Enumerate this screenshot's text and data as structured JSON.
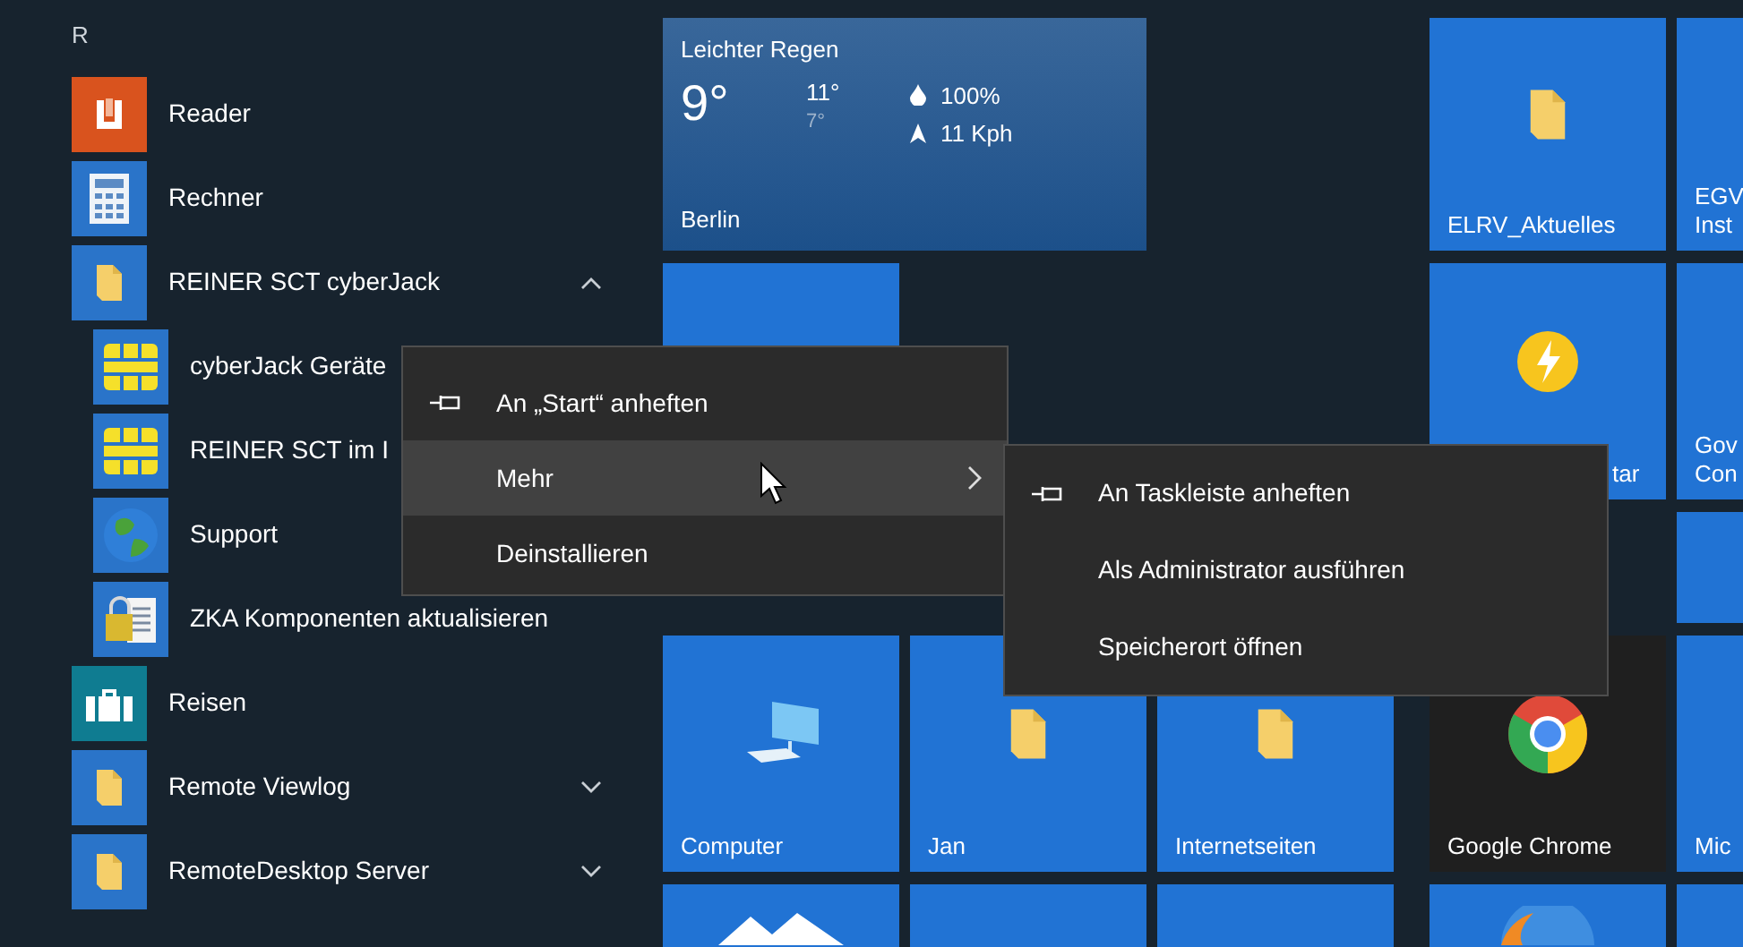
{
  "app_list": {
    "letter": "R",
    "items": [
      {
        "label": "Reader",
        "kind": "reader"
      },
      {
        "label": "Rechner",
        "kind": "calculator"
      },
      {
        "label": "REINER SCT cyberJack",
        "kind": "folder",
        "expanded": true,
        "children": [
          {
            "label": "cyberJack Geräte",
            "kind": "chip"
          },
          {
            "label": "REINER SCT im I",
            "kind": "chip"
          },
          {
            "label": "Support",
            "kind": "globe"
          },
          {
            "label": "ZKA Komponenten aktualisieren",
            "kind": "lock"
          }
        ]
      },
      {
        "label": "Reisen",
        "kind": "suitcase"
      },
      {
        "label": "Remote Viewlog",
        "kind": "folder",
        "expanded": false
      },
      {
        "label": "RemoteDesktop Server",
        "kind": "folder",
        "expanded": false
      }
    ]
  },
  "tile_groups": [
    {
      "tiles": [
        {
          "kind": "weather",
          "condition": "Leichter Regen",
          "temperature": "9°",
          "high": "11°",
          "low": "7°",
          "humidity": "100%",
          "wind": "11 Kph",
          "city": "Berlin"
        },
        {
          "kind": "plain"
        },
        {
          "kind": "computer",
          "label": "Computer"
        },
        {
          "kind": "folder",
          "label": "Jan"
        },
        {
          "kind": "folder",
          "label": "Internetseiten"
        },
        {
          "kind": "peaks"
        },
        {
          "kind": "plain"
        },
        {
          "kind": "plain"
        }
      ]
    },
    {
      "tiles": [
        {
          "kind": "folder",
          "label": "ELRV_Aktuelles"
        },
        {
          "kind": "plain",
          "label": "EGV Inst"
        },
        {
          "kind": "lightning",
          "label": "tar"
        },
        {
          "kind": "plain",
          "label": "Gov Con"
        },
        {
          "kind": "plain"
        },
        {
          "kind": "chrome",
          "label": "Google Chrome"
        },
        {
          "kind": "plain",
          "label": "Mic"
        },
        {
          "kind": "orb"
        },
        {
          "kind": "plain"
        }
      ]
    }
  ],
  "context_menu": {
    "items": [
      {
        "label": "An „Start“ anheften",
        "kind": "pin",
        "selected": false
      },
      {
        "label": "Mehr",
        "kind": "submenu",
        "selected": true
      },
      {
        "label": "Deinstallieren",
        "kind": "plain",
        "selected": false
      }
    ]
  },
  "submenu": {
    "items": [
      {
        "label": "An Taskleiste anheften",
        "kind": "pin",
        "selected": false
      },
      {
        "label": "Als Administrator ausführen",
        "kind": "plain",
        "selected": false
      },
      {
        "label": "Speicherort öffnen",
        "kind": "plain",
        "selected": false
      }
    ]
  }
}
